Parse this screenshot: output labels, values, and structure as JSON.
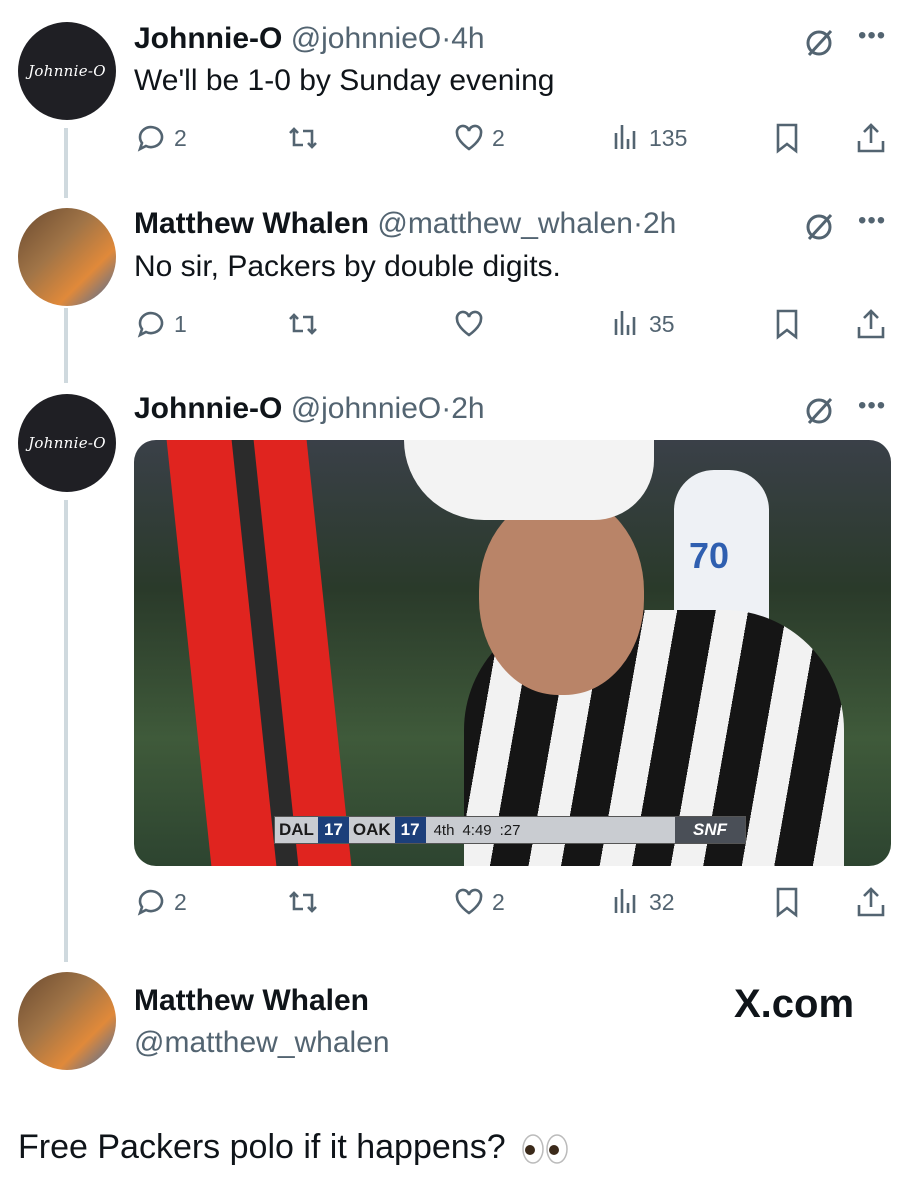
{
  "tweets": [
    {
      "avatar_text": "Johnnie-O",
      "name": "Johnnie-O",
      "handle": "@johnnieO",
      "separator": "·",
      "time": "4h",
      "text": "We'll be 1-0 by Sunday evening",
      "replies": "2",
      "reposts": "",
      "likes": "2",
      "views": "135"
    },
    {
      "name": "Matthew Whalen",
      "handle": "@matthew_whalen",
      "separator": "·",
      "time": "2h",
      "text": "No sir, Packers by double digits.",
      "replies": "1",
      "reposts": "",
      "likes": "",
      "views": "35"
    },
    {
      "avatar_text": "Johnnie-O",
      "name": "Johnnie-O",
      "handle": "@johnnieO",
      "separator": "·",
      "time": "2h",
      "replies": "2",
      "reposts": "",
      "likes": "2",
      "views": "32",
      "media": {
        "scorebug": {
          "team1": "DAL",
          "score1": "17",
          "team2": "OAK",
          "score2": "17",
          "quarter": "4th",
          "clock": "4:49",
          "playclock": ":27",
          "network": "SNF"
        },
        "jersey_number": "70"
      }
    }
  ],
  "final_tweet": {
    "name": "Matthew Whalen",
    "handle": "@matthew_whalen",
    "watermark": "X.com",
    "text": "Free Packers polo if it happens?"
  },
  "icons": {
    "reply": "reply-icon",
    "repost": "repost-icon",
    "like": "like-icon",
    "views": "views-icon",
    "bookmark": "bookmark-icon",
    "share": "share-icon",
    "grok": "grok-icon",
    "more": "more-icon"
  },
  "colors": {
    "text": "#0f1419",
    "secondary": "#536471",
    "thread_line": "#cfd9de"
  }
}
